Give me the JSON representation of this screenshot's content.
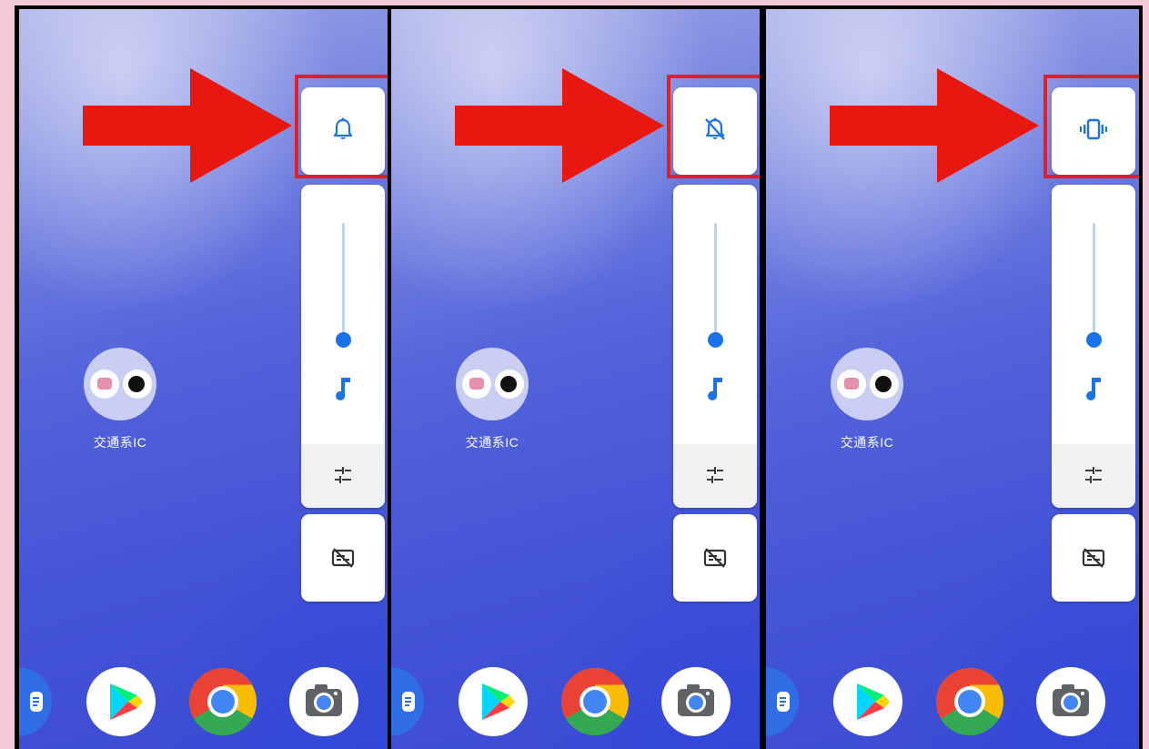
{
  "panels": [
    {
      "id": "panel-1",
      "ringer_mode": "ring",
      "ringer_icon": "bell-icon",
      "volume_level": 0.0
    },
    {
      "id": "panel-2",
      "ringer_mode": "mute",
      "ringer_icon": "bell-off-icon",
      "volume_level": 0.0
    },
    {
      "id": "panel-3",
      "ringer_mode": "vibrate",
      "ringer_icon": "vibrate-icon",
      "volume_level": 0.0
    }
  ],
  "folder": {
    "label": "交通系IC",
    "apps": [
      "transit-app-icon",
      "nfc-app-icon"
    ]
  },
  "volume_panel": {
    "stream_icon": "music-note-icon",
    "settings_icon": "tune-icon",
    "captions_icon": "captions-off-icon"
  },
  "dock": {
    "apps": [
      "messages-icon",
      "play-store-icon",
      "chrome-icon",
      "camera-icon"
    ]
  },
  "colors": {
    "accent": "#1a73e8",
    "highlight": "#e31e24",
    "arrow": "#e8170f",
    "border": "#000000",
    "background": "#f3c8d9"
  }
}
